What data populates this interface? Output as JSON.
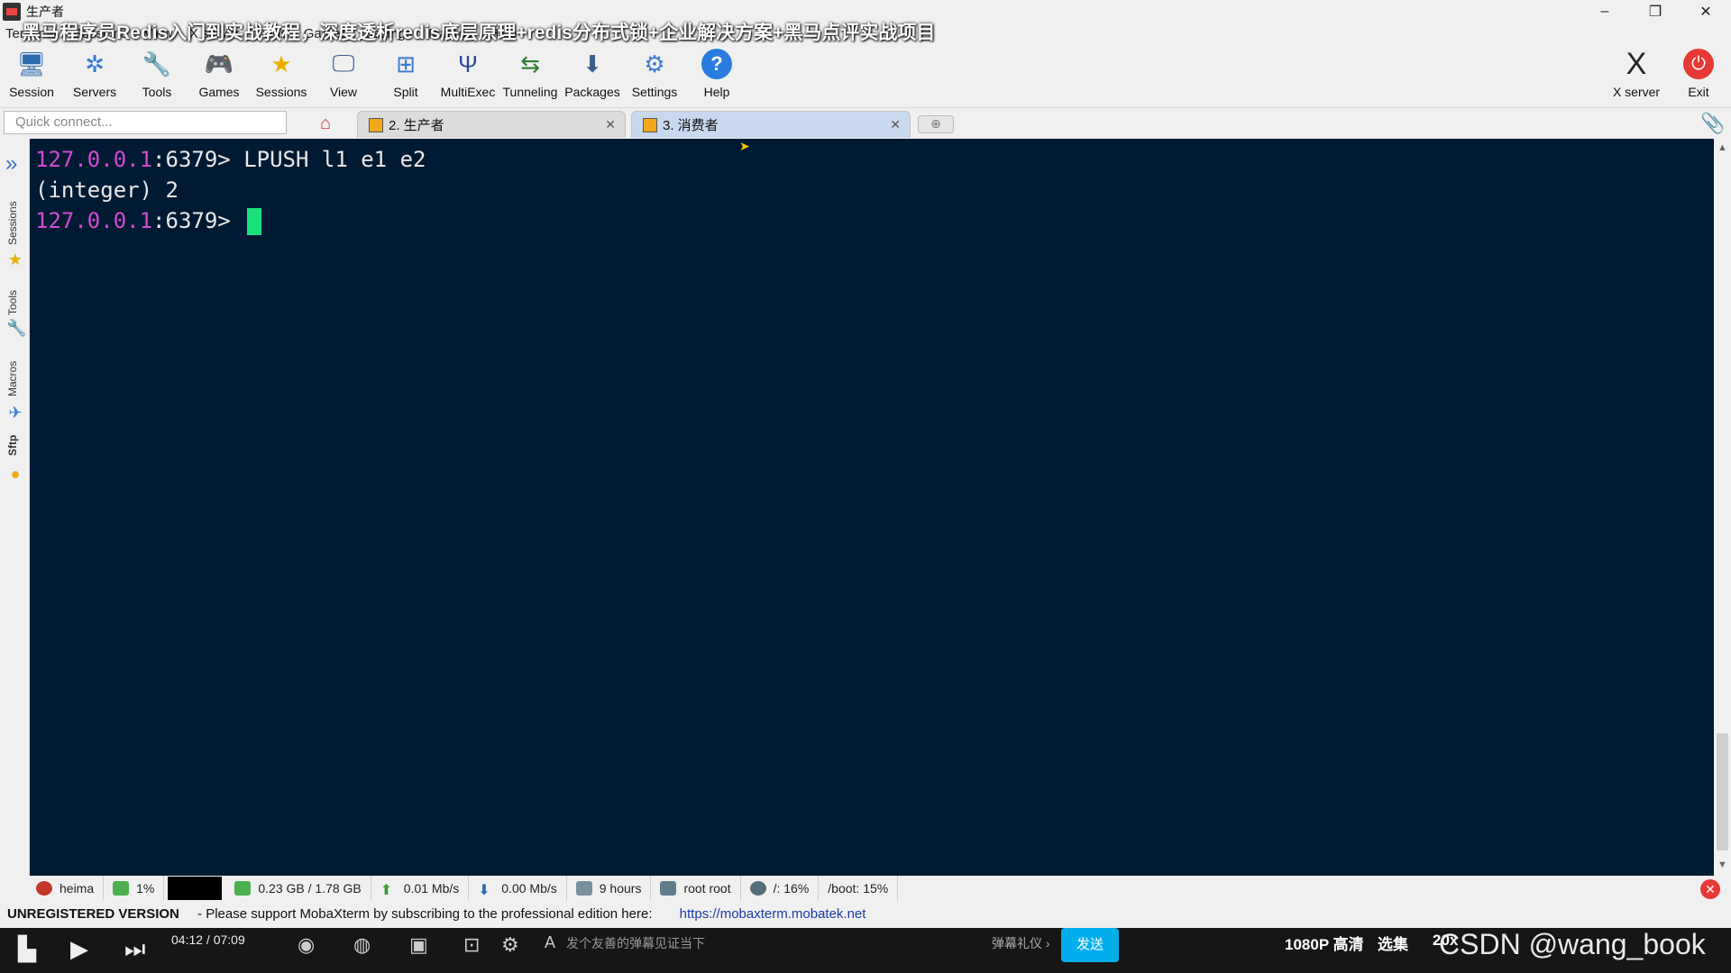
{
  "window": {
    "title": "生产者",
    "video_title": "黑马程序员Redis入门到实战教程，深度透析redis底层原理+redis分布式锁+企业解决方案+黑马点评实战项目"
  },
  "menu": [
    "Terminal",
    "Sessions",
    "View",
    "X server",
    "Tools",
    "Games",
    "Settings",
    "Macros",
    "Help"
  ],
  "toolbar": [
    {
      "label": "Session",
      "icon": "session-icon"
    },
    {
      "label": "Servers",
      "icon": "servers-icon"
    },
    {
      "label": "Tools",
      "icon": "tools-icon"
    },
    {
      "label": "Games",
      "icon": "games-icon"
    },
    {
      "label": "Sessions",
      "icon": "star-icon"
    },
    {
      "label": "View",
      "icon": "view-icon"
    },
    {
      "label": "Split",
      "icon": "split-icon"
    },
    {
      "label": "MultiExec",
      "icon": "multiexec-icon"
    },
    {
      "label": "Tunneling",
      "icon": "tunneling-icon"
    },
    {
      "label": "Packages",
      "icon": "packages-icon"
    },
    {
      "label": "Settings",
      "icon": "settings-icon"
    },
    {
      "label": "Help",
      "icon": "help-icon"
    }
  ],
  "toolbar_right": [
    {
      "label": "X server",
      "icon": "x-server-icon"
    },
    {
      "label": "Exit",
      "icon": "power-icon"
    }
  ],
  "quick_connect_placeholder": "Quick connect...",
  "tabs": [
    {
      "label": "2. 生产者",
      "active": true
    },
    {
      "label": "3. 消费者",
      "active": false
    }
  ],
  "side_tabs": [
    "Sessions",
    "Tools",
    "Macros",
    "Sftp"
  ],
  "terminal": {
    "lines": [
      {
        "ip": "127.0.0.1",
        "rest": ":6379> LPUSH l1 e1 e2"
      },
      {
        "ip": "",
        "rest": "(integer) 2"
      },
      {
        "ip": "127.0.0.1",
        "rest": ":6379> "
      }
    ]
  },
  "status": {
    "host": "heima",
    "cpu": "1%",
    "memory": "0.23 GB / 1.78 GB",
    "upload": "0.01 Mb/s",
    "download": "0.00 Mb/s",
    "uptime": "9 hours",
    "user": "root  root",
    "disk_root": "/: 16%",
    "disk_boot": "/boot: 15%"
  },
  "unregistered": {
    "label": "UNREGISTERED VERSION",
    "message": "-  Please support MobaXterm by subscribing to the professional edition here:",
    "link": "https://mobaxterm.mobatek.net"
  },
  "player": {
    "time": "04:12 / 07:09",
    "danmaku_placeholder": "发个友善的弹幕见证当下",
    "danmaku_gift": "弹幕礼仪 ›",
    "send": "发送",
    "quality": "1080P 高清",
    "episodes": "选集",
    "speed": "20x",
    "watermark": "CSDN @wang_book"
  },
  "colors": {
    "terminal_bg": "#001a33",
    "prompt_ip": "#d14bd1",
    "cursor": "#19e07a",
    "send_button": "#00aeec"
  }
}
